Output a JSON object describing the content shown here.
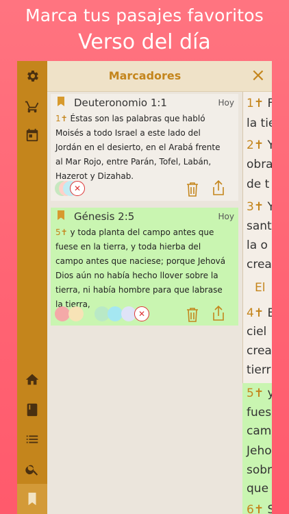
{
  "promo": {
    "line1": "Marca tus pasajes favoritos",
    "line2": "Verso del día"
  },
  "sidebar": {
    "icons": [
      "gear-icon",
      "cart-icon",
      "calendar-icon",
      "home-icon",
      "book-icon",
      "list-icon",
      "search-icon",
      "bookmark-icon"
    ],
    "active": "bookmark-icon"
  },
  "panel": {
    "title": "Marcadores",
    "close_icon": "×",
    "bookmarks": [
      {
        "reference": "Deuteronomio 1:1",
        "date": "Hoy",
        "verse_number": "1✝",
        "verse_lines": [
          " Éstas son las palabras que habló",
          "Moisés a todo Israel a este lado del",
          "Jordán en el desierto, en el Arabá frente",
          "al Mar Rojo, entre Parán, Tofel, Labán,",
          "Hazerot y Dizahab."
        ],
        "colors": [
          "#c7e8c0",
          "#ffd1c9",
          "#c1ecf3"
        ]
      },
      {
        "reference": "Génesis 2:5",
        "date": "Hoy",
        "verse_number": "5✝",
        "verse_lines": [
          " y toda planta del campo antes que",
          "fuese en la tierra, y toda hierba del",
          "campo antes que naciese; porque Jehová",
          "Dios aún no había hecho llover sobre la",
          "tierra, ni había hombre para que labrase",
          "la tierra,"
        ],
        "colors": [
          "#f4a9a8",
          "#f7e3b6",
          "#b9e9c6",
          "#a5e7f2",
          "#dfe3f7"
        ]
      }
    ]
  },
  "reader": {
    "lines": [
      {
        "num": "1✝",
        "text": " F"
      },
      {
        "num": "",
        "text": "la tie"
      },
      {
        "num": "2✝",
        "text": " Y"
      },
      {
        "num": "",
        "text": "obra"
      },
      {
        "num": "",
        "text": "de t"
      },
      {
        "num": "3✝",
        "text": " Y"
      },
      {
        "num": "",
        "text": "sant"
      },
      {
        "num": "",
        "text": "la o"
      },
      {
        "num": "",
        "text": "crea"
      },
      {
        "num": "",
        "text": "El"
      },
      {
        "num": "4✝",
        "text": " E"
      },
      {
        "num": "",
        "text": "ciel"
      },
      {
        "num": "",
        "text": "crea"
      },
      {
        "num": "",
        "text": "tierr"
      },
      {
        "num": "5✝",
        "text": " y"
      },
      {
        "num": "",
        "text": "fues"
      },
      {
        "num": "",
        "text": "cam"
      },
      {
        "num": "",
        "text": "Jeho"
      },
      {
        "num": "",
        "text": "sobr"
      },
      {
        "num": "",
        "text": "que"
      },
      {
        "num": "6✝",
        "text": " S"
      }
    ]
  },
  "colors": {
    "accent": "#c4851c",
    "highlight_green": "#c9f5b1",
    "background_pink": "#ff6474"
  }
}
